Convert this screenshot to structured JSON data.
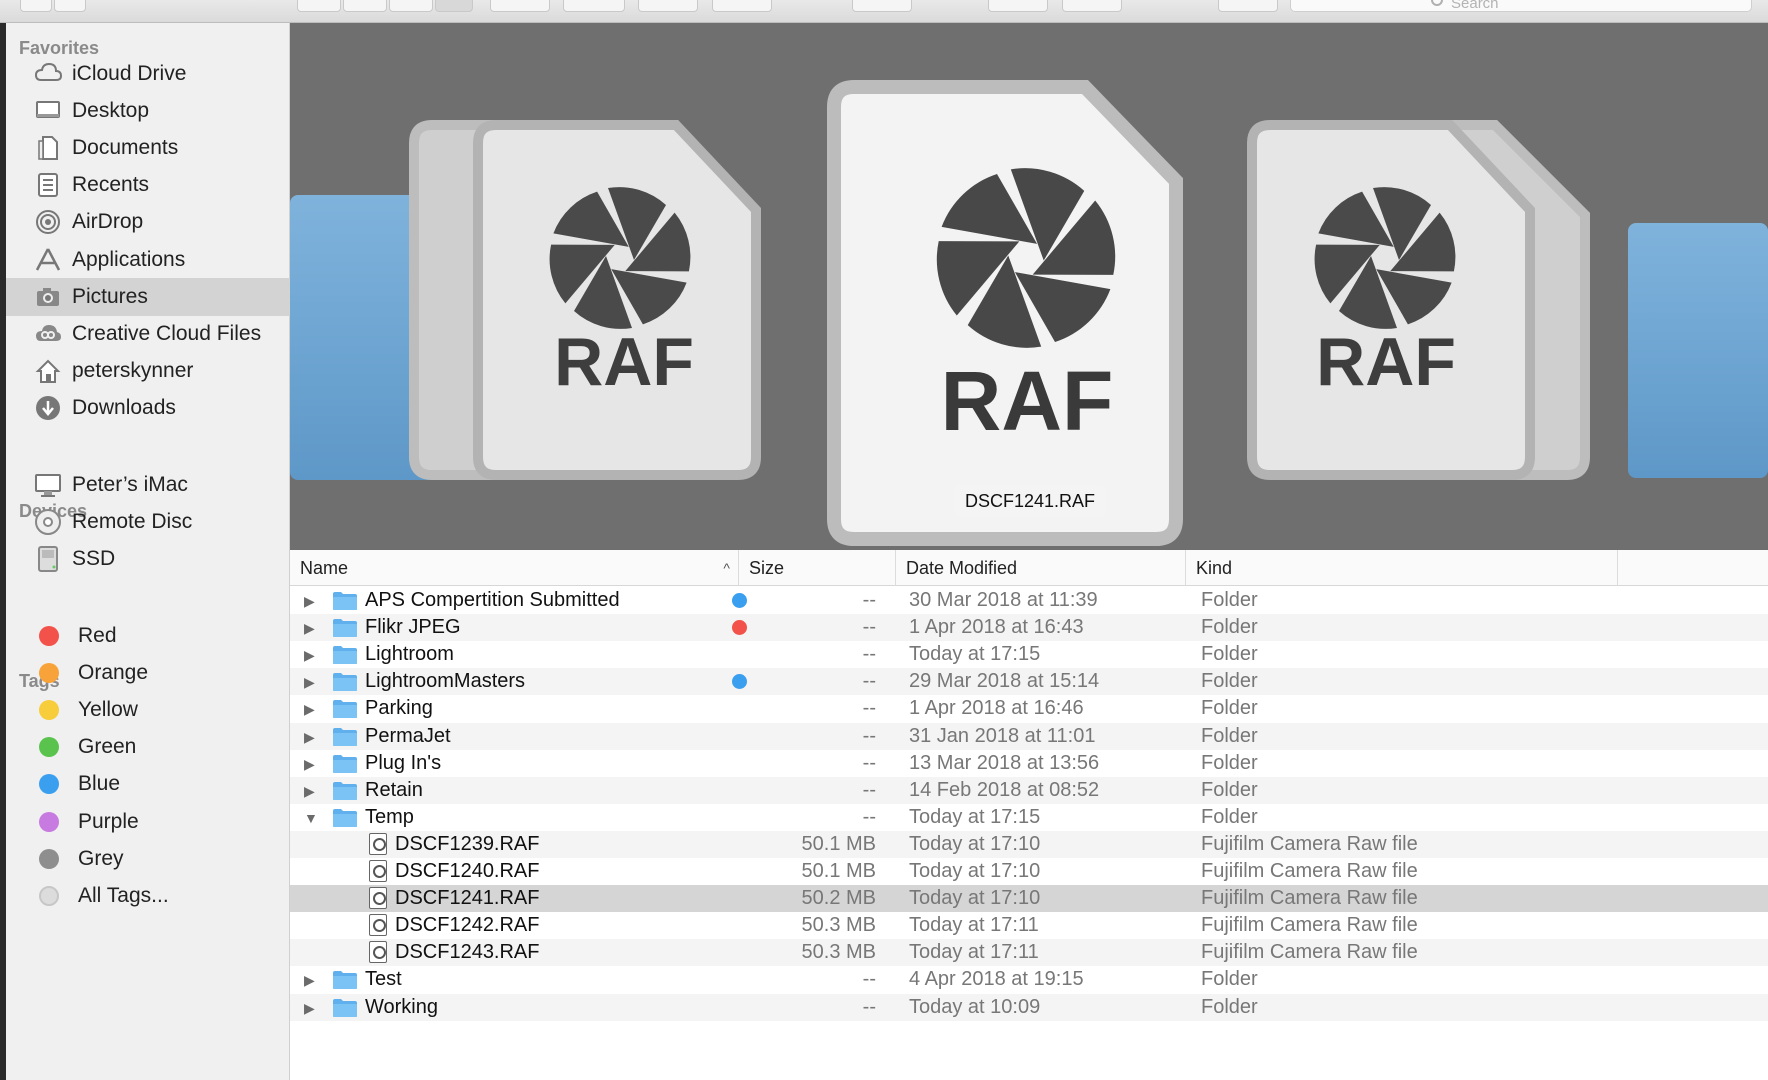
{
  "toolbar": {
    "search_placeholder": "Search"
  },
  "sidebar": {
    "favorites_heading": "Favorites",
    "favorites": [
      {
        "label": "iCloud Drive",
        "icon": "cloud-icon"
      },
      {
        "label": "Desktop",
        "icon": "desktop-icon"
      },
      {
        "label": "Documents",
        "icon": "documents-icon"
      },
      {
        "label": "Recents",
        "icon": "recents-icon"
      },
      {
        "label": "AirDrop",
        "icon": "airdrop-icon"
      },
      {
        "label": "Applications",
        "icon": "applications-icon"
      },
      {
        "label": "Pictures",
        "icon": "camera-icon",
        "selected": true
      },
      {
        "label": "Creative Cloud Files",
        "icon": "creative-cloud-icon"
      },
      {
        "label": "peterskynner",
        "icon": "home-icon"
      },
      {
        "label": "Downloads",
        "icon": "downloads-icon"
      }
    ],
    "devices_heading": "Devices",
    "devices": [
      {
        "label": "Peter’s iMac",
        "icon": "imac-icon"
      },
      {
        "label": "Remote Disc",
        "icon": "disc-icon"
      },
      {
        "label": "SSD",
        "icon": "drive-icon"
      }
    ],
    "tags_heading": "Tags",
    "tags": [
      {
        "label": "Red",
        "color": "#f2524a"
      },
      {
        "label": "Orange",
        "color": "#f7a33a"
      },
      {
        "label": "Yellow",
        "color": "#f7cd3c"
      },
      {
        "label": "Green",
        "color": "#5ac34e"
      },
      {
        "label": "Blue",
        "color": "#3b9ff0"
      },
      {
        "label": "Purple",
        "color": "#c77ae0"
      },
      {
        "label": "Grey",
        "color": "#8e8e8e"
      },
      {
        "label": "All Tags...",
        "color": "#dcdcdc"
      }
    ]
  },
  "preview": {
    "file_type_label": "RAF",
    "caption": "DSCF1241.RAF"
  },
  "list": {
    "columns": {
      "name": "Name",
      "size": "Size",
      "date": "Date Modified",
      "kind": "Kind"
    },
    "rows": [
      {
        "name": "APS Compertition Submitted",
        "size": "--",
        "date": "30 Mar 2018 at 11:39",
        "kind": "Folder",
        "type": "folder",
        "tag": "#3b9ff0"
      },
      {
        "name": "Flikr JPEG",
        "size": "--",
        "date": "1 Apr 2018 at 16:43",
        "kind": "Folder",
        "type": "folder",
        "tag": "#f2524a"
      },
      {
        "name": "Lightroom",
        "size": "--",
        "date": "Today at 17:15",
        "kind": "Folder",
        "type": "folder"
      },
      {
        "name": "LightroomMasters",
        "size": "--",
        "date": "29 Mar 2018 at 15:14",
        "kind": "Folder",
        "type": "folder",
        "tag": "#3b9ff0"
      },
      {
        "name": "Parking",
        "size": "--",
        "date": "1 Apr 2018 at 16:46",
        "kind": "Folder",
        "type": "folder"
      },
      {
        "name": "PermaJet",
        "size": "--",
        "date": "31 Jan 2018 at 11:01",
        "kind": "Folder",
        "type": "folder"
      },
      {
        "name": "Plug In's",
        "size": "--",
        "date": "13 Mar 2018 at 13:56",
        "kind": "Folder",
        "type": "folder"
      },
      {
        "name": "Retain",
        "size": "--",
        "date": "14 Feb 2018 at 08:52",
        "kind": "Folder",
        "type": "folder"
      },
      {
        "name": "Temp",
        "size": "--",
        "date": "Today at 17:15",
        "kind": "Folder",
        "type": "folder",
        "expanded": true
      },
      {
        "name": "DSCF1239.RAF",
        "size": "50.1 MB",
        "date": "Today at 17:10",
        "kind": "Fujifilm Camera Raw file",
        "type": "file"
      },
      {
        "name": "DSCF1240.RAF",
        "size": "50.1 MB",
        "date": "Today at 17:10",
        "kind": "Fujifilm Camera Raw file",
        "type": "file"
      },
      {
        "name": "DSCF1241.RAF",
        "size": "50.2 MB",
        "date": "Today at 17:10",
        "kind": "Fujifilm Camera Raw file",
        "type": "file",
        "selected": true
      },
      {
        "name": "DSCF1242.RAF",
        "size": "50.3 MB",
        "date": "Today at 17:11",
        "kind": "Fujifilm Camera Raw file",
        "type": "file"
      },
      {
        "name": "DSCF1243.RAF",
        "size": "50.3 MB",
        "date": "Today at 17:11",
        "kind": "Fujifilm Camera Raw file",
        "type": "file"
      },
      {
        "name": "Test",
        "size": "--",
        "date": "4 Apr 2018 at 19:15",
        "kind": "Folder",
        "type": "folder"
      },
      {
        "name": "Working",
        "size": "--",
        "date": "Today at 10:09",
        "kind": "Folder",
        "type": "folder"
      }
    ]
  }
}
